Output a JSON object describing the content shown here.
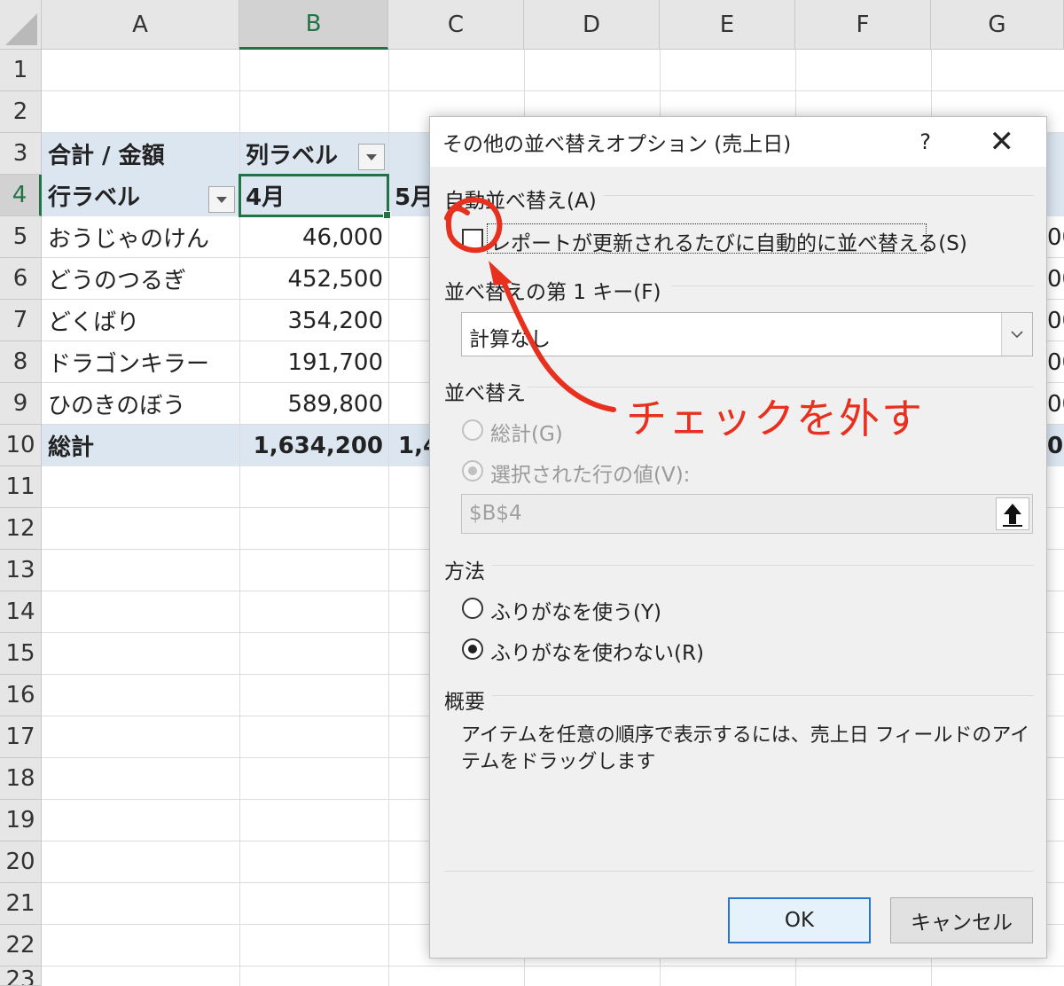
{
  "sheet": {
    "columns": [
      "A",
      "B",
      "C",
      "D",
      "E",
      "F",
      "G"
    ],
    "rows": [
      "1",
      "2",
      "3",
      "4",
      "5",
      "6",
      "7",
      "8",
      "9",
      "10",
      "11",
      "12",
      "13",
      "14",
      "15",
      "16",
      "17",
      "18",
      "19",
      "20",
      "21",
      "22",
      "23"
    ],
    "pivot": {
      "header_sum": "合計 / 金額",
      "column_labels": "列ラベル",
      "row_labels": "行ラベル",
      "month_1": "4月",
      "month_2": "5月",
      "items": [
        {
          "name": "おうじゃのけん",
          "value": "46,000",
          "g_tail": "00"
        },
        {
          "name": "どうのつるぎ",
          "value": "452,500",
          "g_tail": "00"
        },
        {
          "name": "どくばり",
          "value": "354,200",
          "g_tail": "00"
        },
        {
          "name": "ドラゴンキラー",
          "value": "191,700",
          "g_tail": "00"
        },
        {
          "name": "ひのきのぼう",
          "value": "589,800",
          "g_tail": "00"
        }
      ],
      "total_label": "総計",
      "total_value": "1,634,200",
      "total_c_partial": "1,4",
      "total_g_tail": "0"
    }
  },
  "dialog": {
    "title": "その他の並べ替えオプション (売上日)",
    "help": "?",
    "close": "✕",
    "auto_sort": {
      "section": "自動並べ替え(A)",
      "checkbox_label": "レポートが更新されるたびに自動的に並べ替える(S)",
      "checked": false
    },
    "first_key": {
      "label": "並べ替えの第 1 キー(F)",
      "value": "計算なし"
    },
    "sort_by": {
      "section": "並べ替え",
      "total_option": "総計(G)",
      "selected_row_option": "選択された行の値(V):",
      "reference": "$B$4"
    },
    "method": {
      "section": "方法",
      "option_furigana": "ふりがなを使う(Y)",
      "option_no_furigana": "ふりがなを使わない(R)",
      "selected": "no_furigana"
    },
    "summary": {
      "section": "概要",
      "text": "アイテムを任意の順序で表示するには、売上日 フィールドのアイテムをドラッグします"
    },
    "ok": "OK",
    "cancel": "キャンセル"
  },
  "annotation": {
    "text": "チェックを外す",
    "color": "#e8301f"
  },
  "colors": {
    "pivot_band": "#dce6f1",
    "selection": "#217346",
    "ok_border": "#2a74c9"
  }
}
